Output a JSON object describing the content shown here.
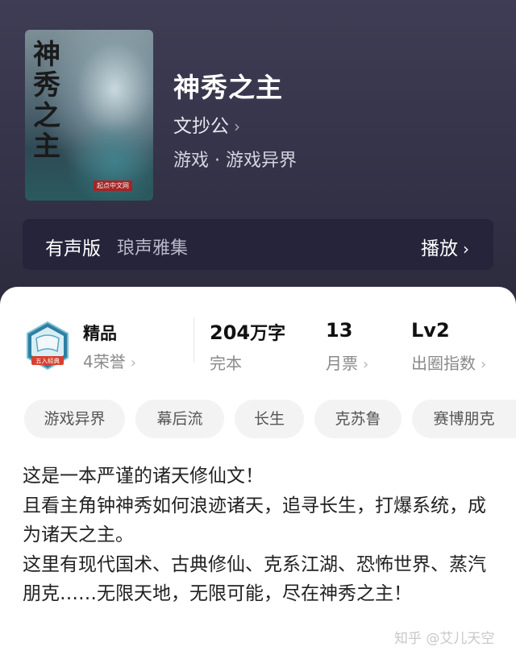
{
  "book": {
    "title": "神秀之主",
    "cover_title_chars": [
      "神",
      "秀",
      "之",
      "主"
    ],
    "cover_publisher": "起点中文网",
    "author": "文抄公",
    "genre": "游戏 · 游戏异界"
  },
  "audio": {
    "label": "有声版",
    "narrator": "琅声雅集",
    "play_label": "播放"
  },
  "stats": {
    "badge_text": "五入经典",
    "rank_label": "精品",
    "honors": "4荣誉",
    "word_count": "204",
    "word_unit": "万字",
    "status": "完本",
    "monthly_votes": "13",
    "monthly_votes_label": "月票",
    "level": "Lv2",
    "level_label": "出圈指数"
  },
  "tags": [
    "游戏异界",
    "幕后流",
    "长生",
    "克苏鲁",
    "赛博朋克"
  ],
  "description": [
    "这是一本严谨的诸天修仙文！",
    "且看主角钟神秀如何浪迹诸天，追寻长生，打爆系统，成为诸天之主。",
    "这里有现代国术、古典修仙、克系江湖、恐怖世界、蒸汽朋克……无限天地，无限可能，尽在神秀之主！"
  ],
  "watermark": "知乎 @艾儿天空",
  "colors": {
    "header_bg": "#36344a",
    "audio_bar_bg": "#25243a",
    "tag_bg": "#f3f3f3"
  },
  "icons": {
    "chevron": "chevron-right-icon",
    "badge": "honor-badge-icon"
  }
}
